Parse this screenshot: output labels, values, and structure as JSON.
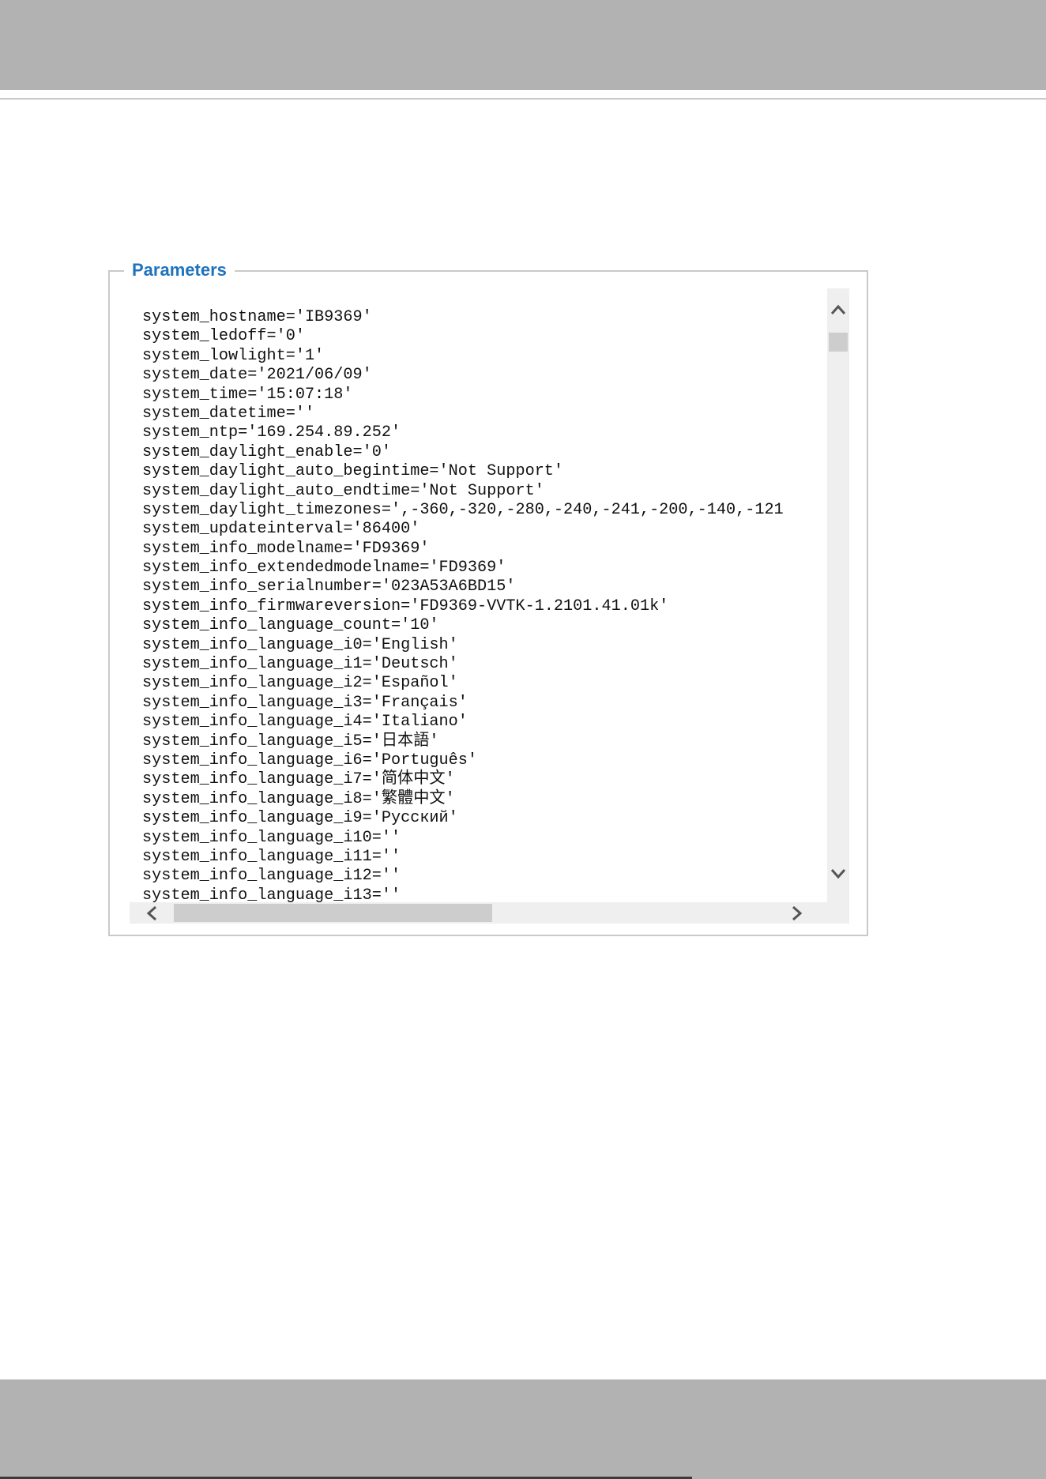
{
  "panel": {
    "legend": "Parameters",
    "lines": [
      "system_hostname='IB9369'",
      "system_ledoff='0'",
      "system_lowlight='1'",
      "system_date='2021/06/09'",
      "system_time='15:07:18'",
      "system_datetime=''",
      "system_ntp='169.254.89.252'",
      "system_daylight_enable='0'",
      "system_daylight_auto_begintime='Not Support'",
      "system_daylight_auto_endtime='Not Support'",
      "system_daylight_timezones=',-360,-320,-280,-240,-241,-200,-140,-121",
      "system_updateinterval='86400'",
      "system_info_modelname='FD9369'",
      "system_info_extendedmodelname='FD9369'",
      "system_info_serialnumber='023A53A6BD15'",
      "system_info_firmwareversion='FD9369-VVTK-1.2101.41.01k'",
      "system_info_language_count='10'",
      "system_info_language_i0='English'",
      "system_info_language_i1='Deutsch'",
      "system_info_language_i2='Español'",
      "system_info_language_i3='Français'",
      "system_info_language_i4='Italiano'",
      "system_info_language_i5='日本語'",
      "system_info_language_i6='Português'",
      "system_info_language_i7='简体中文'",
      "system_info_language_i8='繁體中文'",
      "system_info_language_i9='Русский'",
      "system_info_language_i10=''",
      "system_info_language_i11=''",
      "system_info_language_i12=''",
      "system_info_language_i13=''"
    ]
  },
  "scrollbars": {
    "vertical_position": 0.0,
    "horizontal_visible_fraction": 0.46
  },
  "colors": {
    "legend": "#1e73be",
    "band": "#b2b2b2",
    "border": "#c9c9c9"
  },
  "icons": [
    "chevron-up-icon",
    "chevron-down-icon",
    "chevron-left-icon",
    "chevron-right-icon"
  ]
}
